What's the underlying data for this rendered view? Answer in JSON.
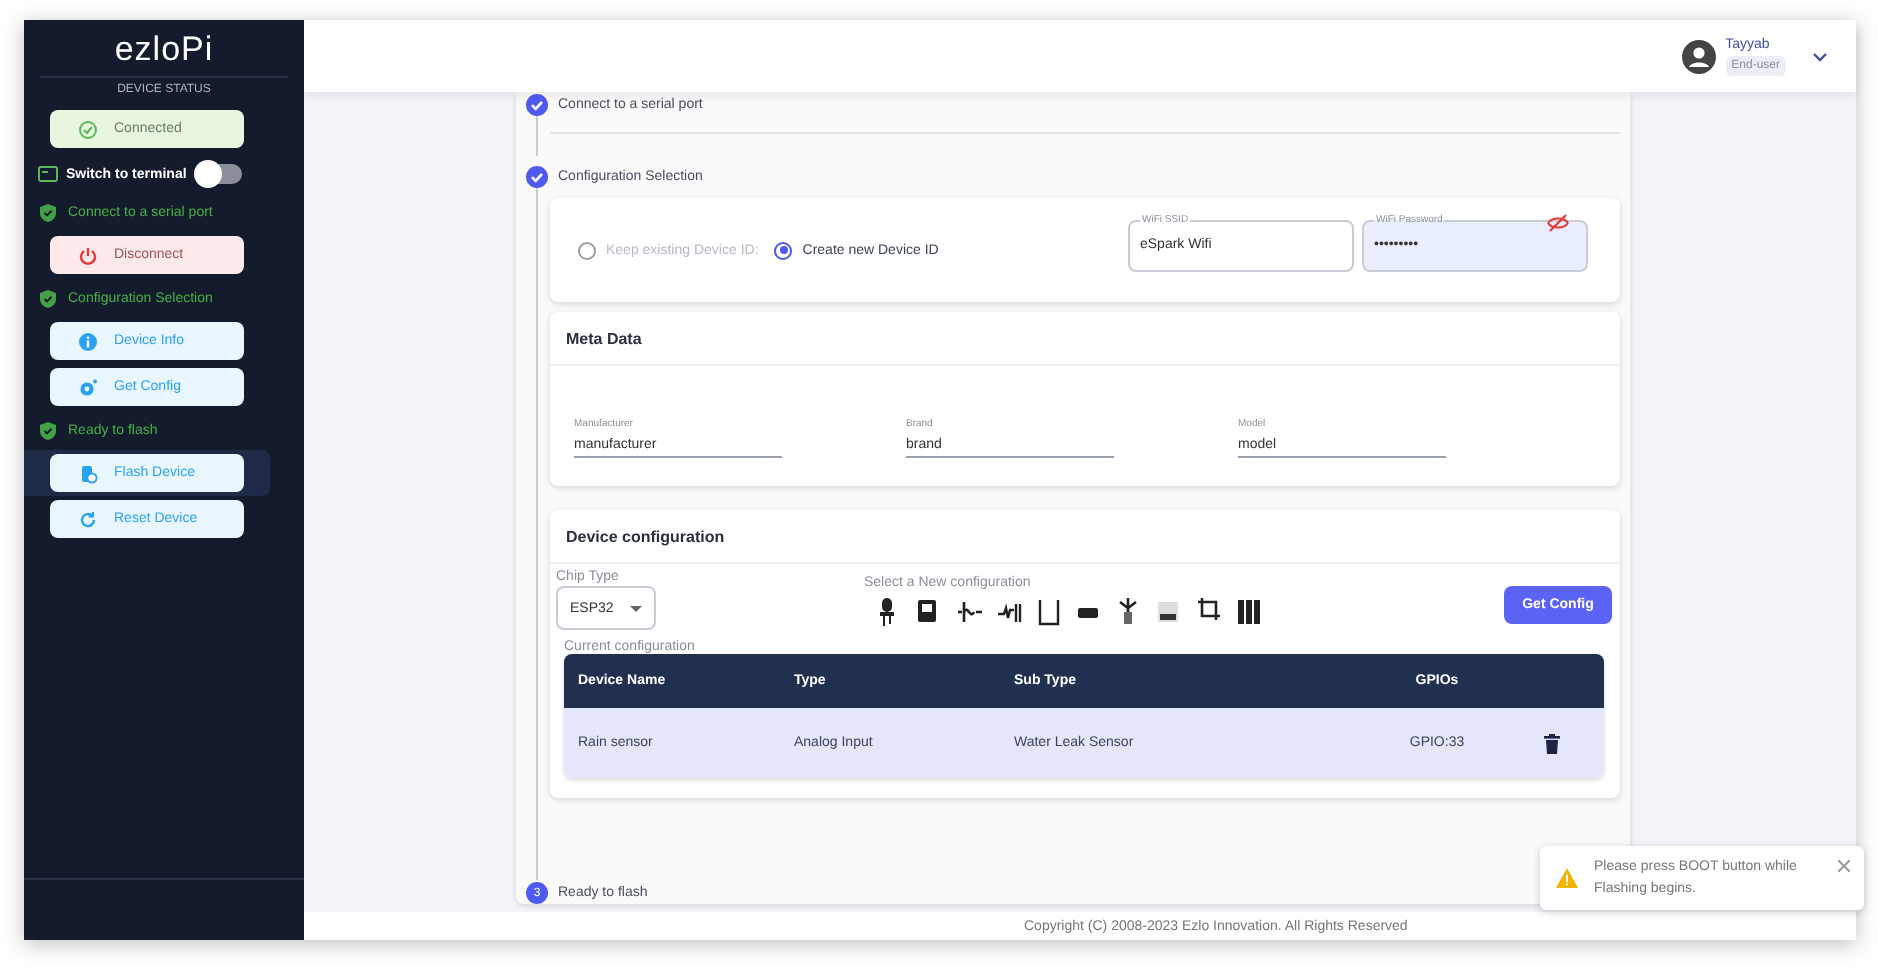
{
  "sidebar": {
    "logo": "ezloPi",
    "status_label": "DEVICE STATUS",
    "items": [
      {
        "kind": "success_button",
        "label": "Connected",
        "selected": false
      },
      {
        "kind": "toggle",
        "label": "Switch to terminal",
        "on": false
      },
      {
        "kind": "step",
        "label": "Connect to a serial port"
      },
      {
        "kind": "danger_button",
        "label": "Disconnect",
        "selected": false
      },
      {
        "kind": "step",
        "label": "Configuration Selection"
      },
      {
        "kind": "info_button",
        "label": "Device Info",
        "selected": false
      },
      {
        "kind": "info_button",
        "label": "Get Config",
        "selected": false
      },
      {
        "kind": "step",
        "label": "Ready to flash"
      },
      {
        "kind": "info_button",
        "label": "Flash Device",
        "selected": true
      },
      {
        "kind": "info_button",
        "label": "Reset Device",
        "selected": false
      }
    ]
  },
  "header": {
    "user_name": "Tayyab",
    "user_role": "End-user"
  },
  "steps": [
    {
      "label": "Connect to a serial port",
      "done": true
    },
    {
      "label": "Configuration Selection",
      "done": true
    },
    {
      "label": "Ready to flash",
      "done": false,
      "number": "3"
    }
  ],
  "config": {
    "radios": [
      {
        "label": "Keep existing Device ID:",
        "selected": false,
        "disabled": true
      },
      {
        "label": "Create new Device ID",
        "selected": true,
        "disabled": false
      }
    ],
    "wifi_ssid": {
      "label": "WiFi SSID",
      "value": "eSpark Wifi"
    },
    "wifi_password": {
      "label": "WiFi Password",
      "value": "•••••••••"
    }
  },
  "meta_data": {
    "title": "Meta Data",
    "fields": [
      {
        "label": "Manufacturer",
        "value": "manufacturer"
      },
      {
        "label": "Brand",
        "value": "brand"
      },
      {
        "label": "Model",
        "value": "model"
      }
    ]
  },
  "device_configuration": {
    "title": "Device configuration",
    "chip_type": {
      "label": "Chip Type",
      "value": "ESP32"
    },
    "select_label": "Select a New configuration",
    "button": "Get Config",
    "current_label": "Current configuration",
    "table": {
      "columns": [
        "Device Name",
        "Type",
        "Sub Type",
        "GPIOs"
      ],
      "rows": [
        {
          "cells": [
            "Rain sensor",
            "Analog Input",
            "Water Leak Sensor",
            "GPIO:33"
          ]
        }
      ]
    }
  },
  "footer": "Copyright (C) 2008-2023 Ezlo Innovation. All Rights Reserved",
  "toast": {
    "message": "Please press BOOT button while Flashing begins."
  }
}
